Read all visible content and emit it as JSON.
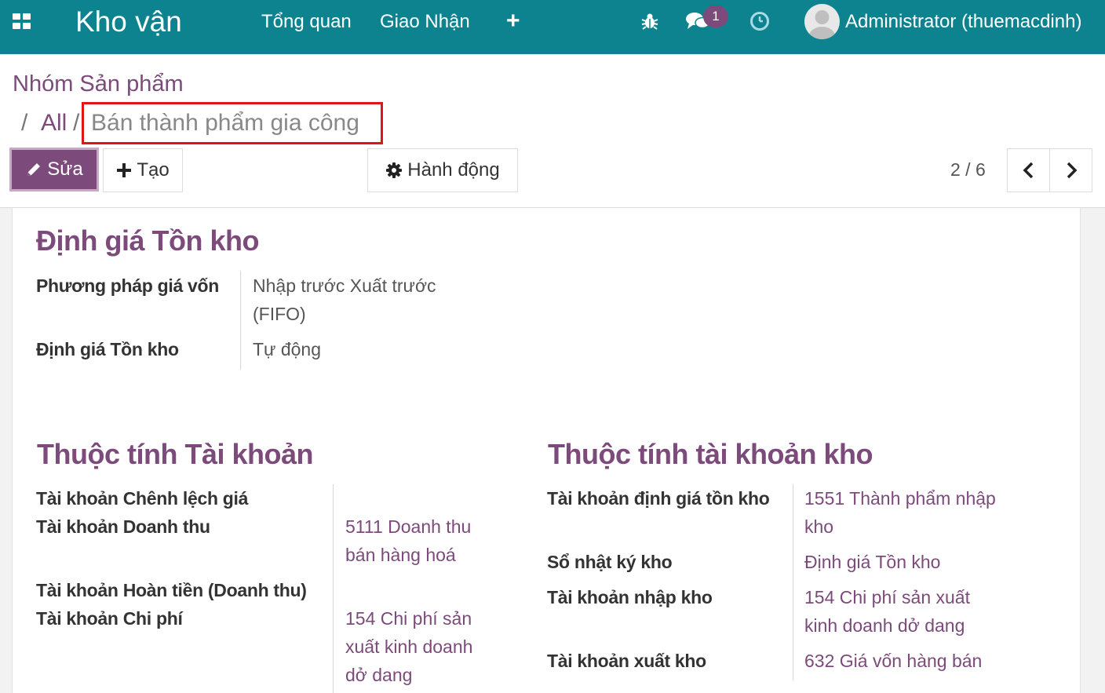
{
  "navbar": {
    "brand": "Kho vận",
    "menu": [
      "Tổng quan",
      "Giao Nhận"
    ],
    "plus_symbol": "+",
    "chat_badge": "1",
    "user": "Administrator (thuemacdinh)",
    "icons": [
      "apps-icon",
      "bug-icon",
      "chat-icon",
      "clock-icon",
      "avatar"
    ],
    "color": "#0e8390"
  },
  "breadcrumb": {
    "root": "Nhóm Sản phẩm",
    "sep": "/",
    "all": "All",
    "current": "Bán thành phẩm gia công"
  },
  "toolbar": {
    "edit_label": "Sửa",
    "create_label": "Tạo",
    "action_label": "Hành động",
    "pager": "2 / 6"
  },
  "inventory_valuation": {
    "title": "Định giá Tồn kho",
    "costing_method_label": "Phương pháp giá vốn",
    "costing_method_value": [
      "Nhập trước Xuất trước",
      "(FIFO)"
    ],
    "valuation_label": "Định giá Tồn kho",
    "valuation_value": "Tự động"
  },
  "account_properties": {
    "title": "Thuộc tính Tài khoản",
    "price_diff_label": "Tài khoản Chênh lệch giá",
    "income_label": "Tài khoản Doanh thu",
    "income_value": [
      "5111 Doanh thu",
      "bán hàng hoá"
    ],
    "refund_label": "Tài khoản Hoàn tiền (Doanh thu)",
    "expense_label": "Tài khoản Chi phí",
    "expense_value": [
      "154 Chi phí sản",
      "xuất kinh doanh",
      "dở dang"
    ]
  },
  "stock_account_properties": {
    "title": "Thuộc tính tài khoản kho",
    "valuation_account_label": "Tài khoản định giá tồn kho",
    "valuation_account_value": [
      "1551 Thành phẩm nhập",
      "kho"
    ],
    "journal_label": "Sổ nhật ký kho",
    "journal_value": "Định giá Tồn kho",
    "input_label": "Tài khoản nhập kho",
    "input_value": [
      "154 Chi phí sản xuất",
      "kinh doanh dở dang"
    ],
    "output_label": "Tài khoản xuất kho",
    "output_value": "632 Giá vốn hàng bán"
  },
  "colors": {
    "accent": "#7c4a7b",
    "highlight": "#e01616"
  }
}
